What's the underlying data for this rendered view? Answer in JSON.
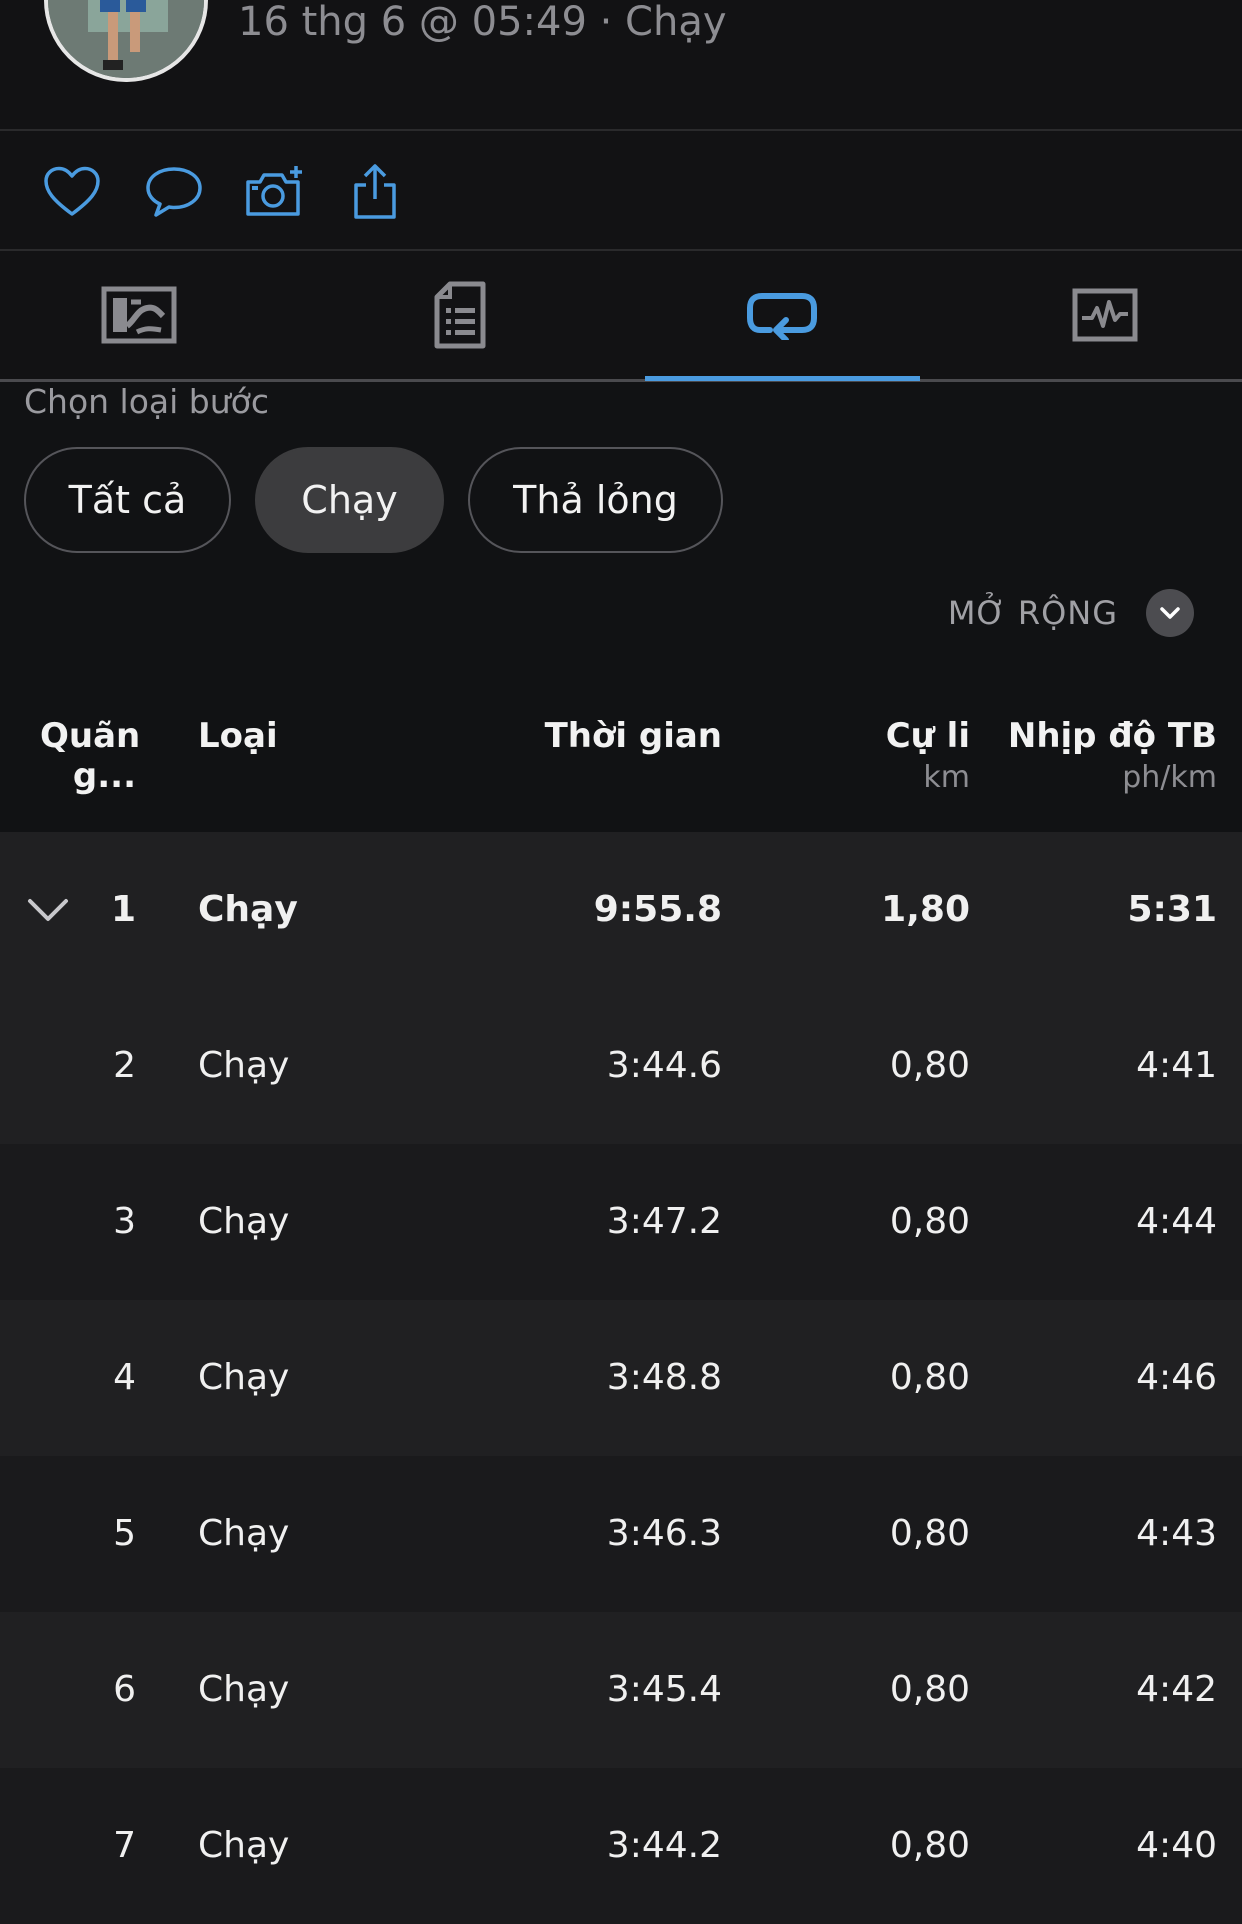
{
  "header": {
    "meta": "16 thg 6 @ 05:49 · Chạy"
  },
  "actions": [
    "heart-icon",
    "comment-icon",
    "camera-add-icon",
    "share-icon"
  ],
  "tabs": [
    {
      "icon": "map-icon",
      "active": false
    },
    {
      "icon": "document-icon",
      "active": false
    },
    {
      "icon": "laps-icon",
      "active": true
    },
    {
      "icon": "chart-icon",
      "active": false
    }
  ],
  "filter": {
    "label": "Chọn loại bước",
    "chips": [
      {
        "label": "Tất cả",
        "active": false
      },
      {
        "label": "Chạy",
        "active": true
      },
      {
        "label": "Thả lỏng",
        "active": false
      }
    ]
  },
  "expand": {
    "label": "MỞ RỘNG"
  },
  "table": {
    "headers": {
      "lap_line1": "Quãn",
      "lap_line2": "g...",
      "type": "Loại",
      "time": "Thời gian",
      "distance": "Cự li",
      "distance_unit": "km",
      "pace": "Nhịp độ TB",
      "pace_unit": "ph/km"
    },
    "rows": [
      {
        "lap": "1",
        "type": "Chạy",
        "time": "9:55.8",
        "distance": "1,80",
        "pace": "5:31"
      },
      {
        "lap": "2",
        "type": "Chạy",
        "time": "3:44.6",
        "distance": "0,80",
        "pace": "4:41"
      },
      {
        "lap": "3",
        "type": "Chạy",
        "time": "3:47.2",
        "distance": "0,80",
        "pace": "4:44"
      },
      {
        "lap": "4",
        "type": "Chạy",
        "time": "3:48.8",
        "distance": "0,80",
        "pace": "4:46"
      },
      {
        "lap": "5",
        "type": "Chạy",
        "time": "3:46.3",
        "distance": "0,80",
        "pace": "4:43"
      },
      {
        "lap": "6",
        "type": "Chạy",
        "time": "3:45.4",
        "distance": "0,80",
        "pace": "4:42"
      },
      {
        "lap": "7",
        "type": "Chạy",
        "time": "3:44.2",
        "distance": "0,80",
        "pace": "4:40"
      }
    ]
  },
  "colors": {
    "accent": "#4a9be0",
    "background": "#111214"
  }
}
